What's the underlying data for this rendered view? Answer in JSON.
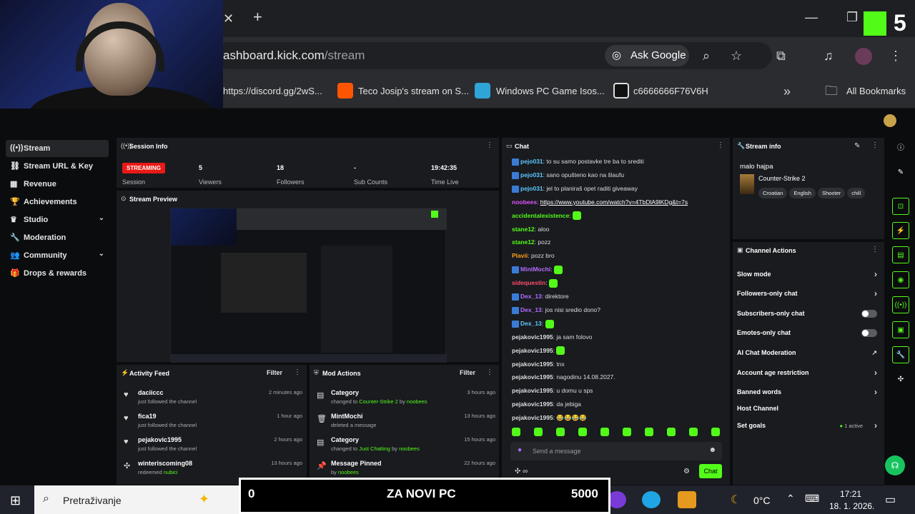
{
  "browser": {
    "url_dim": "ashboard.kick.com",
    "url_path": "/stream",
    "ask_google": "Ask Google",
    "bookmarks": [
      {
        "label": "https://discord.gg/2wS..."
      },
      {
        "label": "Teco Josip's stream on S..."
      },
      {
        "label": "Windows PC Game Isos..."
      },
      {
        "label": "c6666666F76V6H"
      }
    ],
    "all_bookmarks": "All Bookmarks",
    "overlay_number": "5"
  },
  "nav": {
    "items": [
      {
        "label": "Stream",
        "icon": "broadcast-icon",
        "active": true
      },
      {
        "label": "Stream URL & Key",
        "icon": "link-icon"
      },
      {
        "label": "Revenue",
        "icon": "revenue-icon"
      },
      {
        "label": "Achievements",
        "icon": "trophy-icon"
      },
      {
        "label": "Studio",
        "icon": "studio-icon",
        "expandable": true
      },
      {
        "label": "Moderation",
        "icon": "wrench-icon"
      },
      {
        "label": "Community",
        "icon": "users-icon",
        "expandable": true
      },
      {
        "label": "Drops & rewards",
        "icon": "gift-icon"
      }
    ]
  },
  "session": {
    "title": "Session Info",
    "status": "STREAMING",
    "stats": [
      {
        "value": "",
        "label": "Session"
      },
      {
        "value": "5",
        "label": "Viewers"
      },
      {
        "value": "18",
        "label": "Followers"
      },
      {
        "value": "-",
        "label": "Sub Counts"
      },
      {
        "value": "19:42:35",
        "label": "Time Live"
      }
    ]
  },
  "preview": {
    "title": "Stream Preview"
  },
  "activity": {
    "title": "Activity Feed",
    "filter": "Filter",
    "items": [
      {
        "name": "daciiccc",
        "sub": "just followed the channel",
        "time": "2 minutes ago"
      },
      {
        "name": "fica19",
        "sub": "just followed the channel",
        "time": "1 hour ago"
      },
      {
        "name": "pejakovic1995",
        "sub": "just followed the channel",
        "time": "2 hours ago"
      },
      {
        "name": "winteriscoming08",
        "sub": "redeemed ",
        "hl": "nubici",
        "time": "13 hours ago"
      }
    ]
  },
  "mod": {
    "title": "Mod Actions",
    "filter": "Filter",
    "items": [
      {
        "name": "Category",
        "sub": "changed to ",
        "hl": "Counter-Strike 2",
        "by": " by ",
        "user": "noobees",
        "time": "3 hours ago"
      },
      {
        "name": "MintMochi",
        "sub": "deleted a message",
        "hl": "",
        "by": "",
        "user": "",
        "time": "13 hours ago"
      },
      {
        "name": "Category",
        "sub": "changed to ",
        "hl": "Just Chatting",
        "by": " by ",
        "user": "noobees",
        "time": "15 hours ago"
      },
      {
        "name": "Message Pinned",
        "sub": "by ",
        "hl": "",
        "by": "",
        "user": "noobees",
        "time": "22 hours ago"
      }
    ]
  },
  "chat": {
    "title": "Chat",
    "placeholder": "Send a message",
    "send": "Chat",
    "lines": [
      {
        "user": "pejo031",
        "color": "#5cc8ff",
        "text": "to su samo postavke tre ba to srediti",
        "badge": true
      },
      {
        "user": "pejo031",
        "color": "#5cc8ff",
        "text": "sano opušteno kao na šlaufu",
        "badge": true
      },
      {
        "user": "pejo031",
        "color": "#5cc8ff",
        "text": "jel to planiraš opet raditi giveaway",
        "badge": true
      },
      {
        "user": "noobees",
        "color": "#e056fd",
        "text": "",
        "link": "https://www.youtube.com/watch?v=4TbDlA9lKDg&t=7s",
        "badge": false
      },
      {
        "user": "accidentalexistence",
        "color": "#53fc18",
        "text": "",
        "emote": true
      },
      {
        "user": "stane12",
        "color": "#53fc18",
        "text": "aloo"
      },
      {
        "user": "stane12",
        "color": "#53fc18",
        "text": "pozz"
      },
      {
        "user": "Plavii",
        "color": "#ff9f1a",
        "text": "pozz bro"
      },
      {
        "user": "MintMochi",
        "color": "#b36bff",
        "text": "",
        "emote": true,
        "badge": true
      },
      {
        "user": "sidequestin",
        "color": "#ff4d6d",
        "text": "",
        "emote": true
      },
      {
        "user": "Dex_13",
        "color": "#b36bff",
        "text": "direktore",
        "badge": true
      },
      {
        "user": "Dex_13",
        "color": "#b36bff",
        "text": "jos nisi sredio dono?",
        "badge": true
      },
      {
        "user": "Dex_13",
        "color": "#5cc8ff",
        "text": "",
        "emote": true,
        "badge": true
      },
      {
        "user": "pejakovic1995",
        "color": "#dddddd",
        "text": "ja sam folovo"
      },
      {
        "user": "pejakovic1995",
        "color": "#dddddd",
        "text": "",
        "emote": true
      },
      {
        "user": "pejakovic1995",
        "color": "#dddddd",
        "text": "tnx"
      },
      {
        "user": "pejakovic1995",
        "color": "#dddddd",
        "text": "nagodinu 14.08.2027."
      },
      {
        "user": "pejakovic1995",
        "color": "#dddddd",
        "text": "u domu u sps"
      },
      {
        "user": "pejakovic1995",
        "color": "#dddddd",
        "text": "da jebiga"
      },
      {
        "user": "pejakovic1995",
        "color": "#dddddd",
        "text": "😂😂😂😂"
      }
    ]
  },
  "streaminfo": {
    "title": "Stream info",
    "stream_title": "malo hajpa",
    "category": "Counter-Strike 2",
    "tags": [
      "Croatian",
      "English",
      "Shooter",
      "chill"
    ]
  },
  "channel": {
    "title": "Channel Actions",
    "items": [
      {
        "label": "Slow mode",
        "type": "arrow"
      },
      {
        "label": "Followers-only chat",
        "type": "arrow"
      },
      {
        "label": "Subscribers-only chat",
        "type": "toggle"
      },
      {
        "label": "Emotes-only chat",
        "type": "toggle"
      },
      {
        "label": "AI Chat Moderation",
        "type": "external"
      },
      {
        "label": "Account age restriction",
        "type": "arrow"
      },
      {
        "label": "Banned words",
        "type": "arrow"
      },
      {
        "label": "Host Channel",
        "type": "none"
      },
      {
        "label": "Set goals",
        "type": "arrow",
        "extra": "1 active"
      }
    ]
  },
  "taskbar": {
    "search": "Pretraživanje",
    "overlay_left": "0",
    "overlay_title": "ZA NOVI PC",
    "overlay_right": "5000",
    "temp": "0°C",
    "time": "17:21",
    "date": "18. 1. 2026."
  },
  "colors": {
    "accent": "#53fc18",
    "live": "#e91916"
  }
}
